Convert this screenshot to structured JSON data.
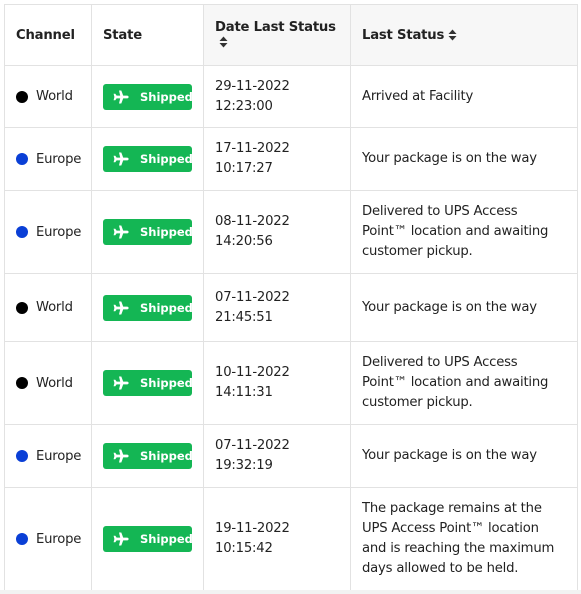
{
  "table": {
    "headers": {
      "channel": "Channel",
      "state": "State",
      "date_last_status": "Date Last Status",
      "last_status": "Last Status"
    },
    "colors": {
      "World": "#000000",
      "Europe": "#0a3fd6",
      "shipped_badge": "#14b654"
    },
    "rows": [
      {
        "channel": "World",
        "channel_color": "#000000",
        "state": "Shipped",
        "date": "29-11-2022",
        "time": "12:23:00",
        "last_status": "Arrived at Facility"
      },
      {
        "channel": "Europe",
        "channel_color": "#0a3fd6",
        "state": "Shipped",
        "date": "17-11-2022",
        "time": "10:17:27",
        "last_status": "Your package is on the way"
      },
      {
        "channel": "Europe",
        "channel_color": "#0a3fd6",
        "state": "Shipped",
        "date": "08-11-2022",
        "time": "14:20:56",
        "last_status": "Delivered to UPS Access Point™ location and awaiting customer pickup."
      },
      {
        "channel": "World",
        "channel_color": "#000000",
        "state": "Shipped",
        "date": "07-11-2022",
        "time": "21:45:51",
        "last_status": "Your package is on the way"
      },
      {
        "channel": "World",
        "channel_color": "#000000",
        "state": "Shipped",
        "date": "10-11-2022",
        "time": "14:11:31",
        "last_status": "Delivered to UPS Access Point™ location and awaiting customer pickup."
      },
      {
        "channel": "Europe",
        "channel_color": "#0a3fd6",
        "state": "Shipped",
        "date": "07-11-2022",
        "time": "19:32:19",
        "last_status": "Your package is on the way"
      },
      {
        "channel": "Europe",
        "channel_color": "#0a3fd6",
        "state": "Shipped",
        "date": "19-11-2022",
        "time": "10:15:42",
        "last_status": "The package remains at the UPS Access Point™ location and is reaching the maximum days allowed to be held."
      }
    ]
  }
}
